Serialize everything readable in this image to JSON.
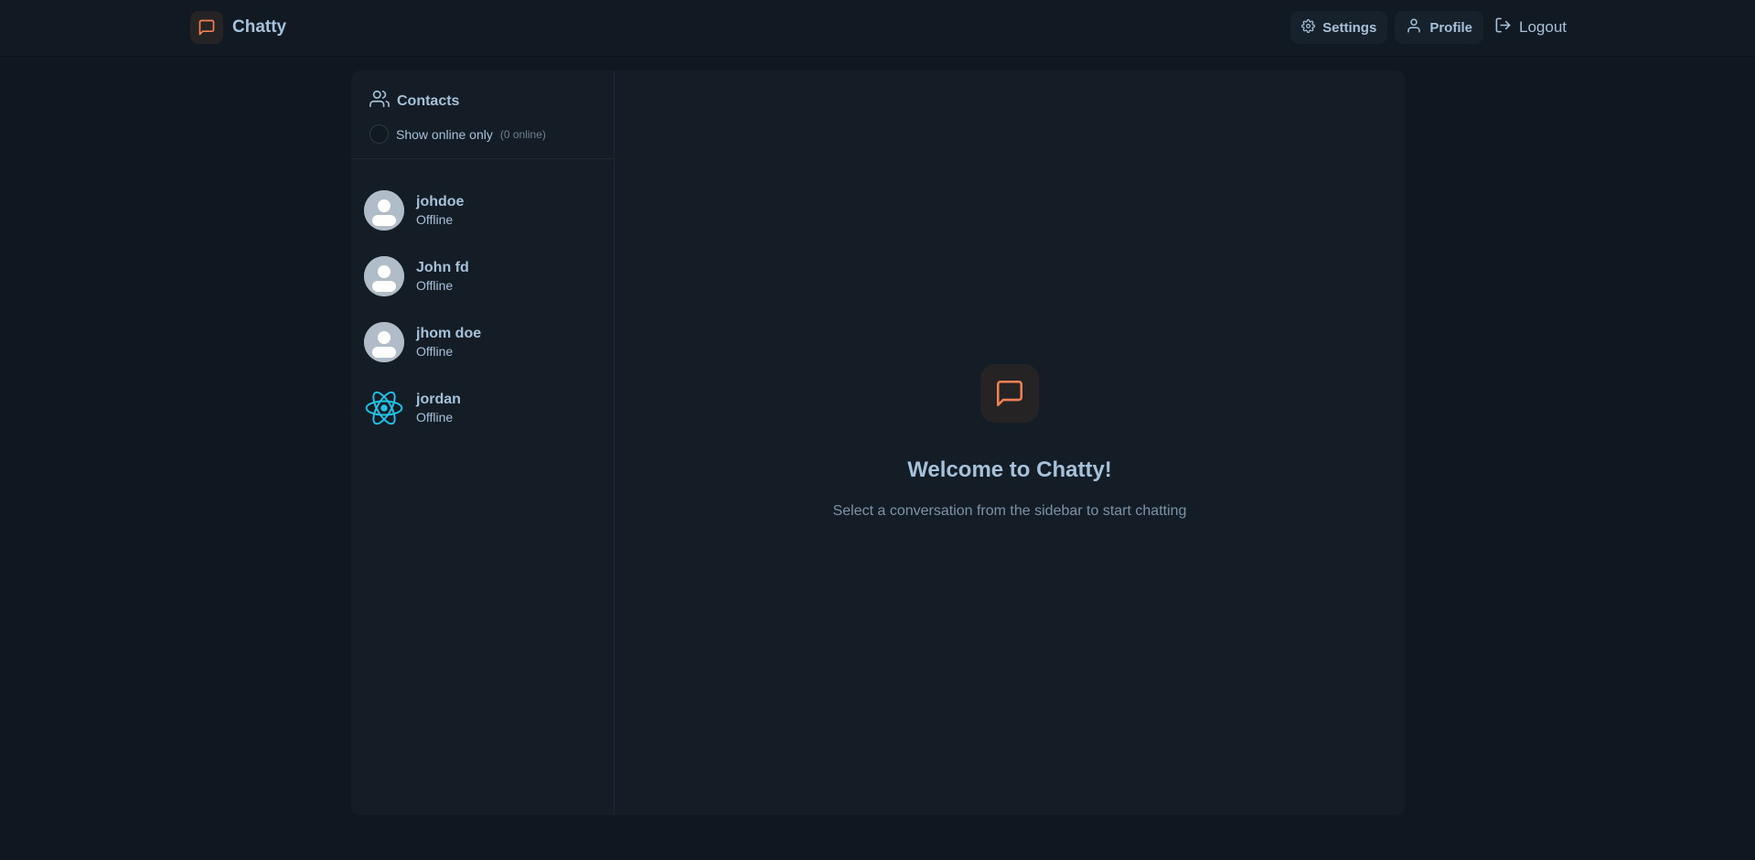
{
  "header": {
    "brand": "Chatty",
    "nav": {
      "settings": "Settings",
      "profile": "Profile",
      "logout": "Logout"
    }
  },
  "sidebar": {
    "title": "Contacts",
    "online_filter_label": "Show online only",
    "online_count": "(0 online)",
    "contacts": [
      {
        "name": "johdoe",
        "status": "Offline",
        "avatar": "default-avatar"
      },
      {
        "name": "John fd",
        "status": "Offline",
        "avatar": "default-avatar"
      },
      {
        "name": "jhom doe",
        "status": "Offline",
        "avatar": "default-avatar"
      },
      {
        "name": "jordan",
        "status": "Offline",
        "avatar": "react-logo"
      }
    ]
  },
  "main": {
    "welcome_title": "Welcome to Chatty!",
    "welcome_subtitle": "Select a conversation from the sidebar to start chatting"
  },
  "colors": {
    "accent": "#f08055",
    "text": "#a6c1da",
    "background": "#0f1820",
    "card": "#141d25"
  }
}
